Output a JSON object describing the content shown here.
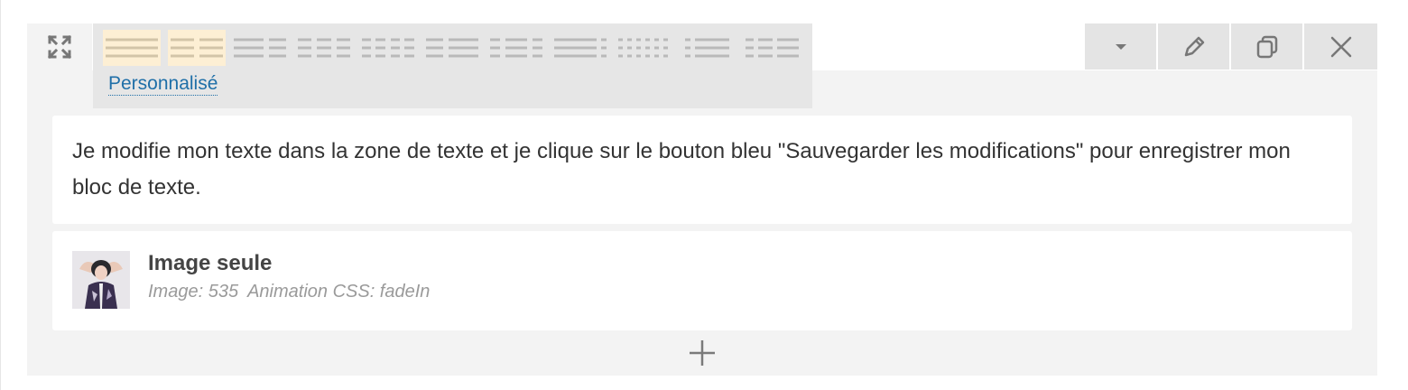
{
  "row": {
    "layout_selector": {
      "custom_label": "Personnalisé",
      "options": [
        {
          "name": "layout-100",
          "selected": true
        },
        {
          "name": "layout-50-50",
          "selected": true
        },
        {
          "name": "layout-67-33",
          "selected": false
        },
        {
          "name": "layout-33-33-33",
          "selected": false
        },
        {
          "name": "layout-25-25-25-25",
          "selected": false
        },
        {
          "name": "layout-33-67",
          "selected": false
        },
        {
          "name": "layout-25-50-25",
          "selected": false
        },
        {
          "name": "layout-75-25",
          "selected": false
        },
        {
          "name": "layout-six-columns",
          "selected": false
        },
        {
          "name": "layout-25-75",
          "selected": false
        },
        {
          "name": "layout-50-25-25",
          "selected": false
        }
      ]
    },
    "actions": [
      {
        "icon": "caret-down-icon"
      },
      {
        "icon": "pencil-icon"
      },
      {
        "icon": "duplicate-icon"
      },
      {
        "icon": "close-icon"
      }
    ]
  },
  "text_block": {
    "content": "Je modifie mon texte dans la zone de texte et je clique sur le bouton bleu \"Sauvegarder les modifications\" pour enregistrer mon bloc de texte."
  },
  "image_widget": {
    "title": "Image seule",
    "meta_image": "Image: 535",
    "meta_animation": "Animation CSS: fadeIn"
  },
  "add_button": {
    "icon": "plus-icon"
  },
  "colors": {
    "panel_bg": "#f3f3f3",
    "layout_panel_bg": "#e6e6e6",
    "selected_layout_bg": "#fdefd4",
    "link_color": "#1f6fa8",
    "icon_gray": "#777777"
  }
}
